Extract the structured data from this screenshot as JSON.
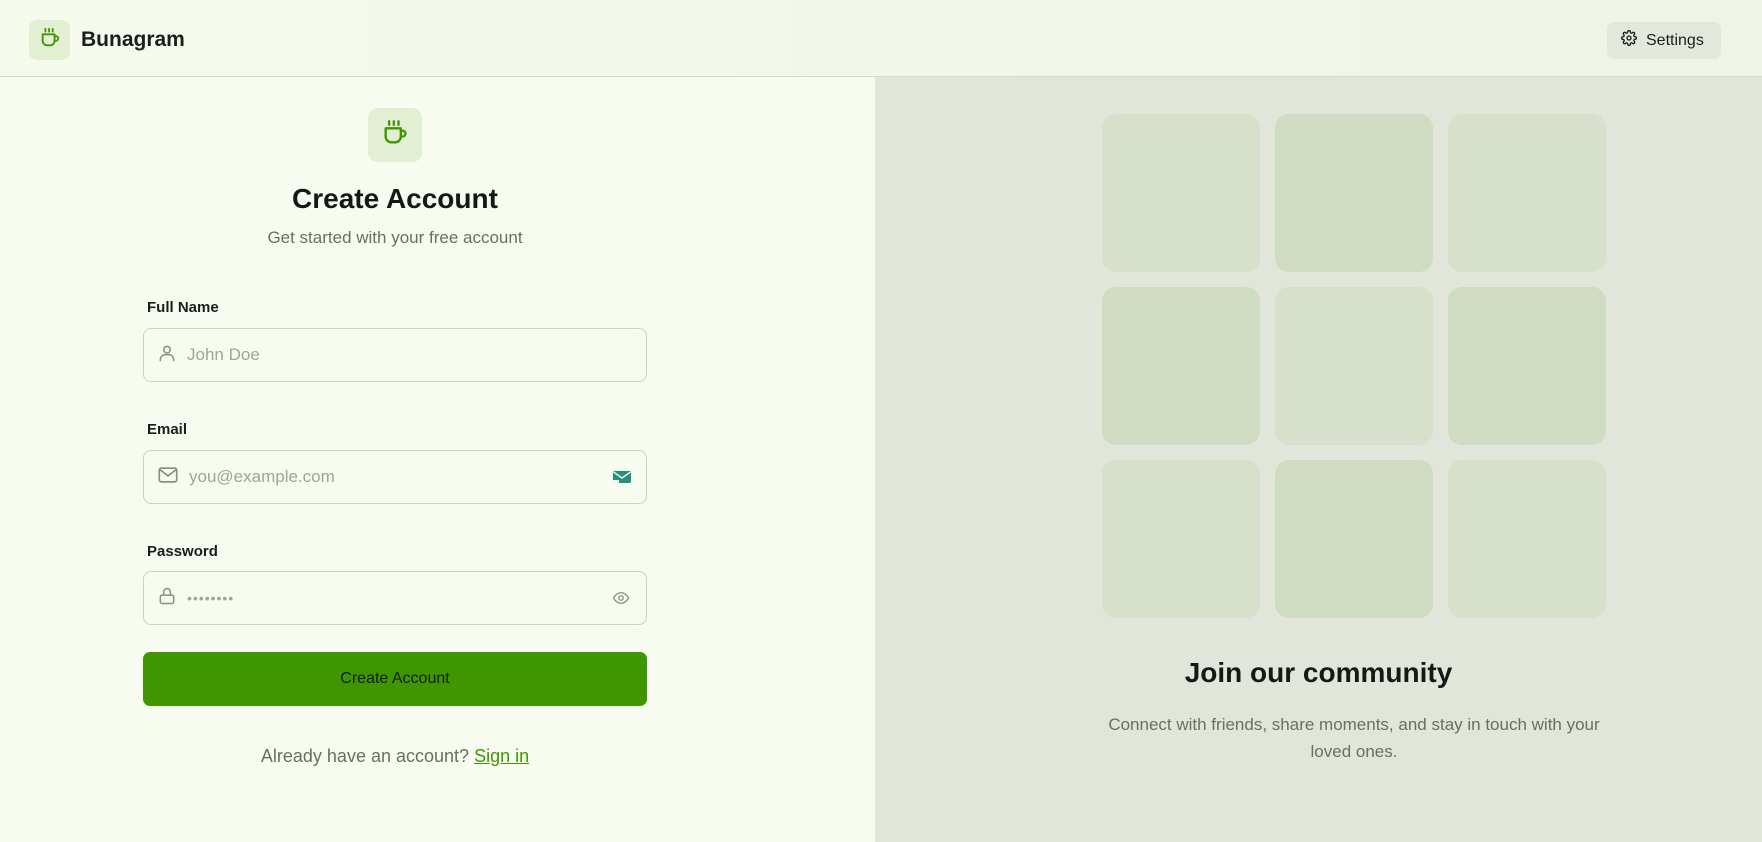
{
  "header": {
    "brand_name": "Bunagram",
    "brand_icon": "coffee-cup-icon",
    "settings_label": "Settings",
    "settings_icon": "gear-icon"
  },
  "form": {
    "icon": "coffee-cup-icon",
    "title": "Create Account",
    "subtitle": "Get started with your free account",
    "full_name": {
      "label": "Full Name",
      "placeholder": "John Doe",
      "icon": "user-icon"
    },
    "email": {
      "label": "Email",
      "placeholder": "you@example.com",
      "icon": "mail-icon",
      "trailing_icon": "email-autofill-icon"
    },
    "password": {
      "label": "Password",
      "placeholder": "••••••••",
      "icon": "lock-icon",
      "trailing_icon": "eye-icon"
    },
    "submit_label": "Create Account",
    "signin_prompt": "Already have an account?",
    "signin_link": "Sign in"
  },
  "community": {
    "title": "Join our community",
    "subtitle": "Connect with friends, share moments, and stay in touch with your loved ones.",
    "tiles": [
      "#d7e0cb",
      "#cfdcc2",
      "#d7e0cb",
      "#cfdcc2",
      "#d7e0cb",
      "#cfdcc2",
      "#d7e0cb",
      "#cfdcc2",
      "#d7e0cb"
    ]
  },
  "colors": {
    "accent": "#3f9600",
    "left_bg": "#f8fbef",
    "right_bg": "#e2e5d9"
  }
}
